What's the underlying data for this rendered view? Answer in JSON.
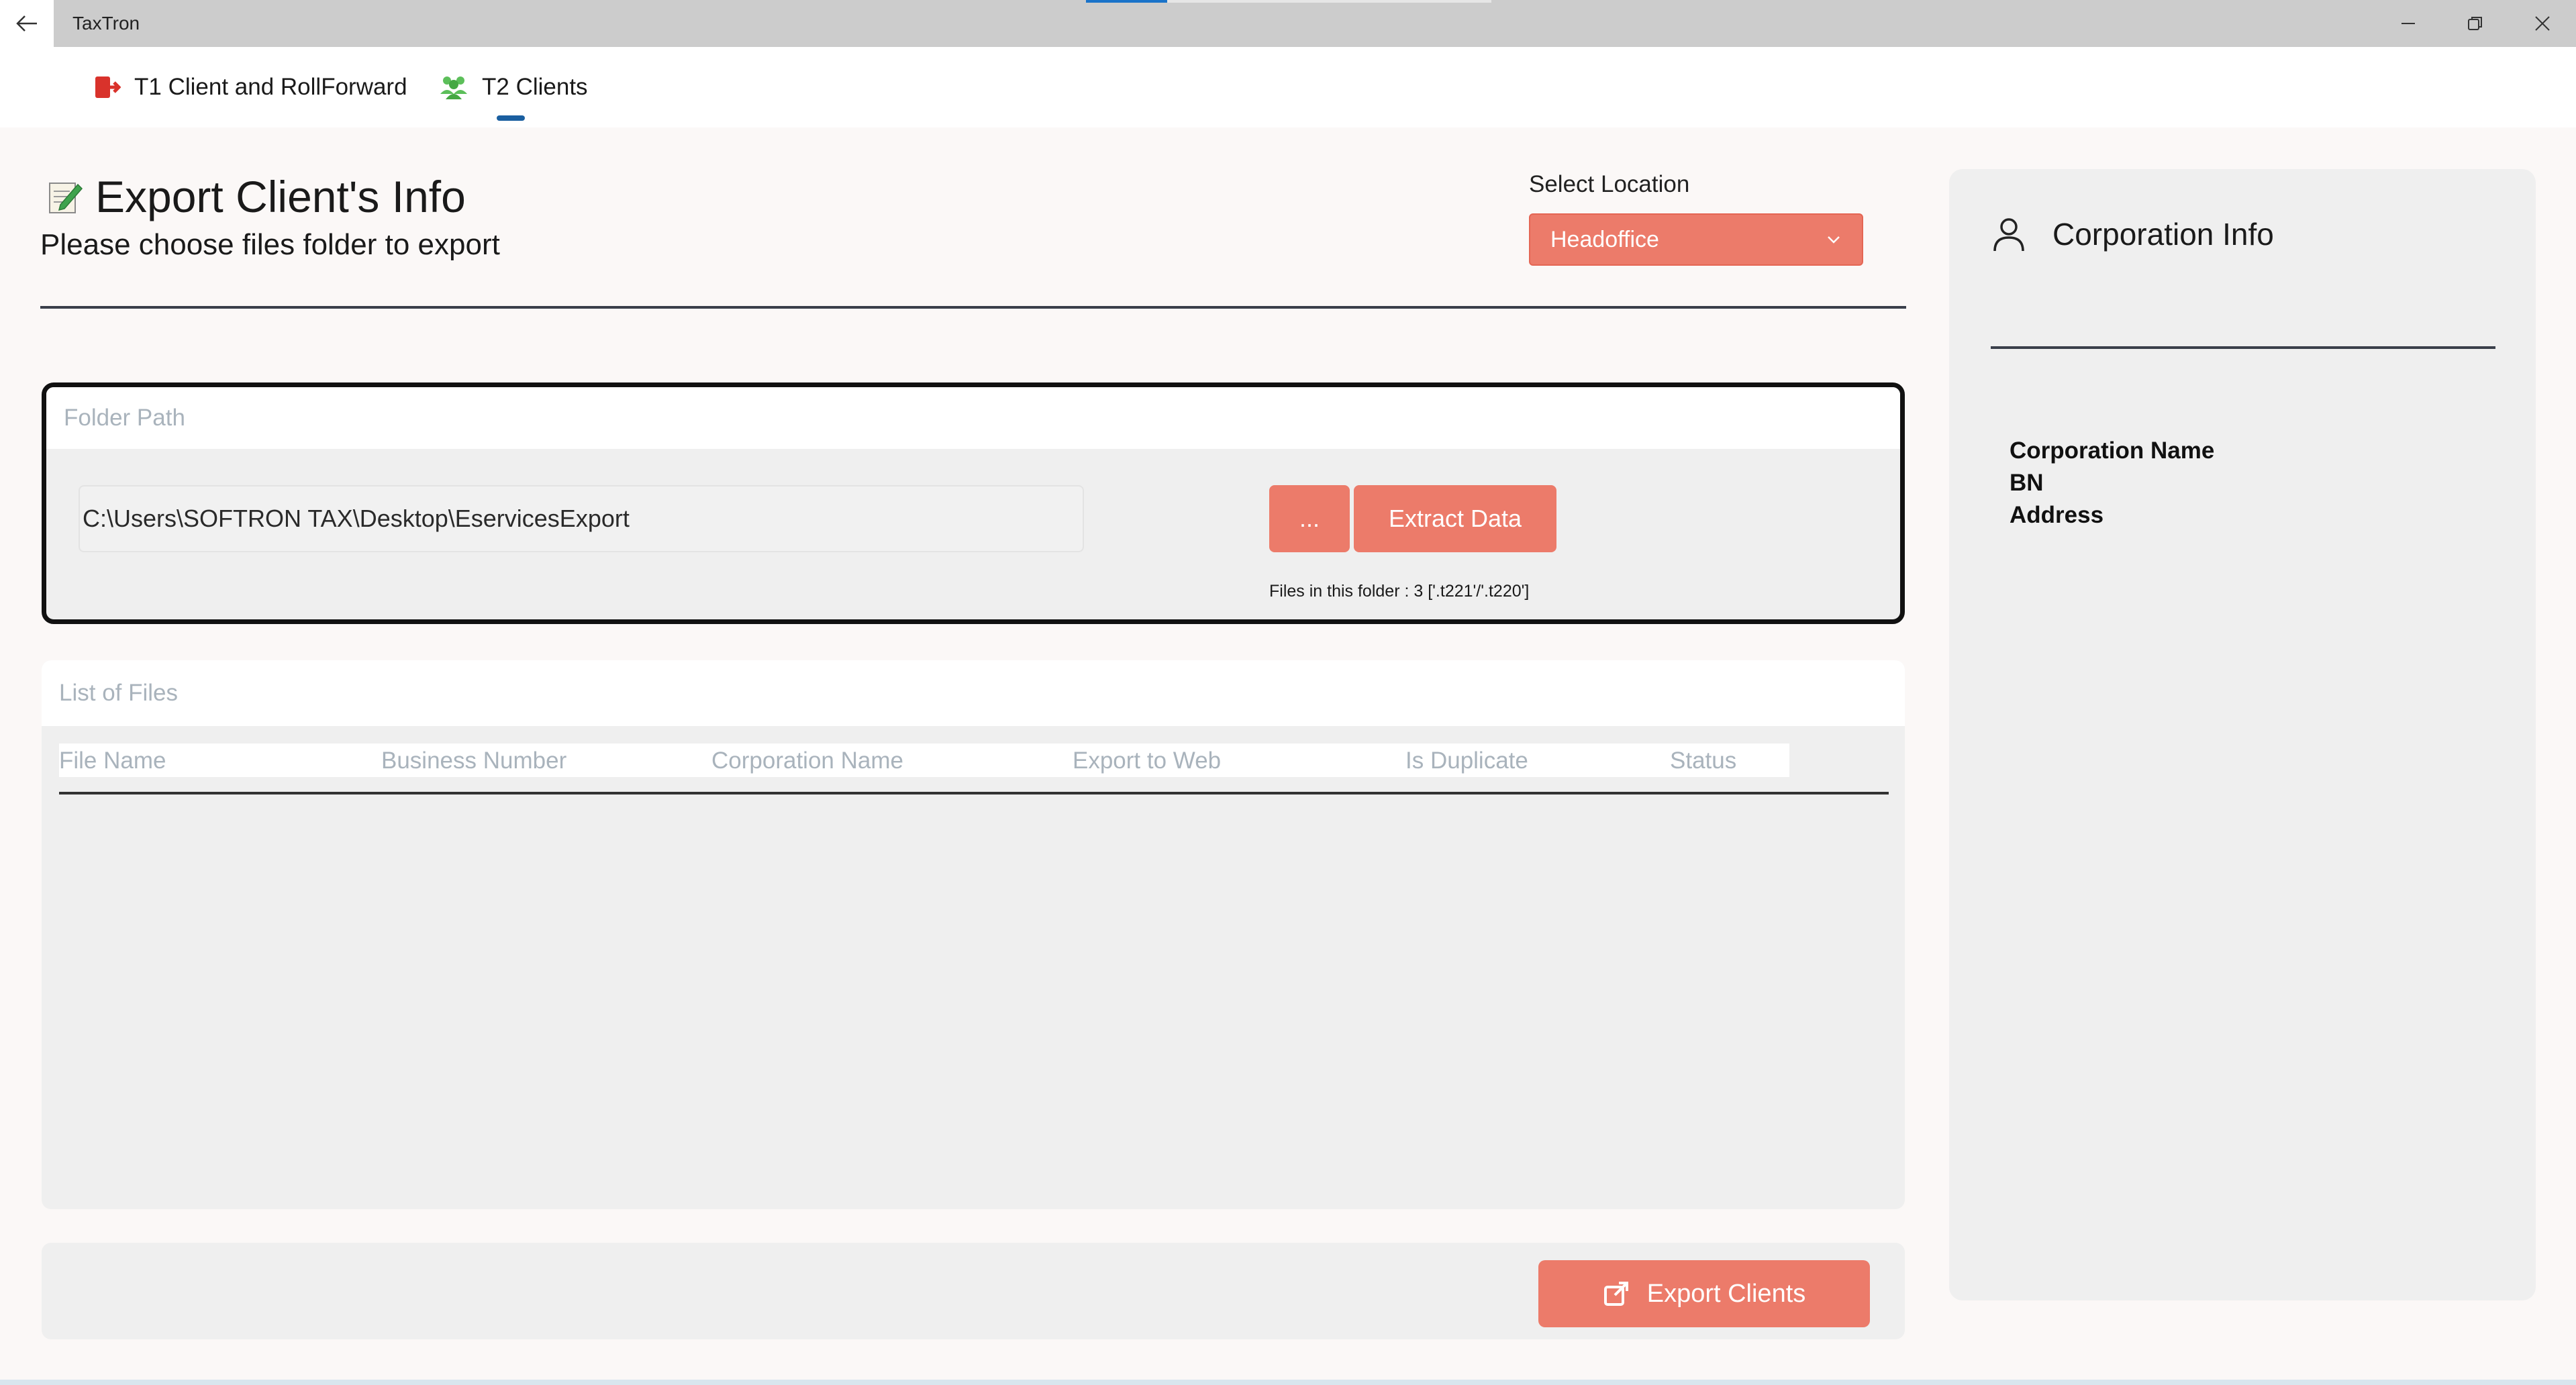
{
  "window": {
    "title": "TaxTron",
    "loading_progress": 0.2
  },
  "tabs": [
    {
      "label": "T1 Client and RollForward",
      "icon": "exit-icon",
      "color": "#d9322b"
    },
    {
      "label": "T2 Clients",
      "icon": "users-icon",
      "color": "#5cbf5a",
      "selected": true
    }
  ],
  "header": {
    "title": "Export Client's Info",
    "subtitle": "Please choose files folder to export",
    "location_label": "Select Location",
    "location_value": "Headoffice"
  },
  "folder": {
    "section_title": "Folder Path",
    "path": "C:\\Users\\SOFTRON TAX\\Desktop\\EservicesExport",
    "browse_label": "...",
    "extract_label": "Extract Data",
    "files_info": "Files in this folder : 3 ['.t221'/'.t220']"
  },
  "list": {
    "section_title": "List of Files",
    "columns": [
      "File Name",
      "Business Number",
      "Corporation Name",
      "Export to Web",
      "Is Duplicate",
      "Status"
    ],
    "rows": []
  },
  "export_button": "Export Clients",
  "corporation": {
    "title": "Corporation Info",
    "fields": [
      "Corporation Name",
      "BN",
      "Address"
    ]
  },
  "colors": {
    "accent": "#ec7b6a",
    "tab_indicator": "#1a5fa0"
  }
}
